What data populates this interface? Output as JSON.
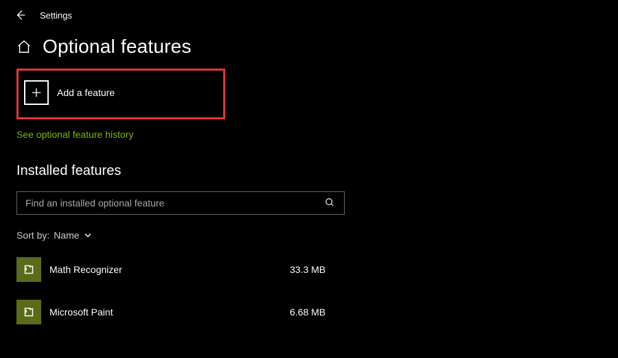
{
  "app_title": "Settings",
  "page_title": "Optional features",
  "add_feature": {
    "label": "Add a feature"
  },
  "history_link": "See optional feature history",
  "section_title": "Installed features",
  "search": {
    "placeholder": "Find an installed optional feature"
  },
  "sort": {
    "prefix": "Sort by:",
    "value": "Name"
  },
  "features": [
    {
      "name": "Math Recognizer",
      "size": "33.3 MB"
    },
    {
      "name": "Microsoft Paint",
      "size": "6.68 MB"
    }
  ]
}
